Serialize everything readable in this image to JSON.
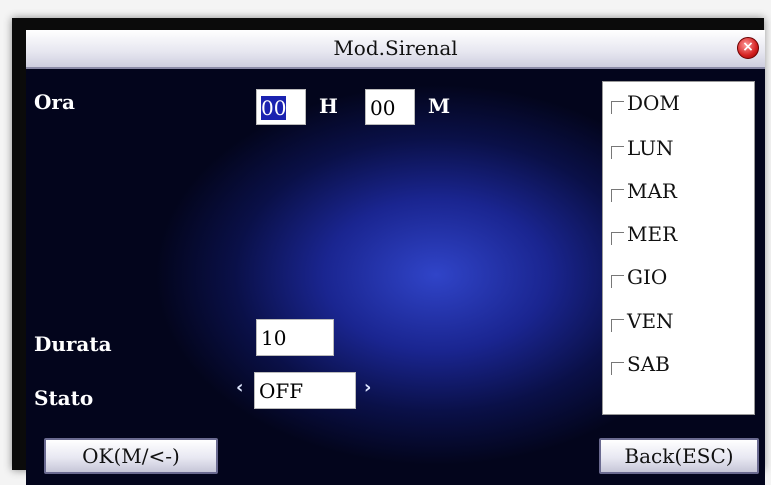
{
  "window": {
    "title": "Mod.Sirenal",
    "close_icon": "close-icon"
  },
  "time": {
    "label": "Ora",
    "hours_value": "00",
    "hours_unit": "H",
    "minutes_value": "00",
    "minutes_unit": "M"
  },
  "duration": {
    "label": "Durata",
    "value": "10"
  },
  "status": {
    "label": "Stato",
    "value": "OFF",
    "left_arrow": "‹",
    "right_arrow": "›"
  },
  "days": [
    {
      "label": "DOM",
      "checked": false
    },
    {
      "label": "LUN",
      "checked": false
    },
    {
      "label": "MAR",
      "checked": false
    },
    {
      "label": "MER",
      "checked": false
    },
    {
      "label": "GIO",
      "checked": false
    },
    {
      "label": "VEN",
      "checked": false
    },
    {
      "label": "SAB",
      "checked": false
    }
  ],
  "buttons": {
    "ok": "OK(M/<-)",
    "back": "Back(ESC)"
  },
  "colors": {
    "accent": "#1a22b0",
    "background": "#0a1048"
  }
}
